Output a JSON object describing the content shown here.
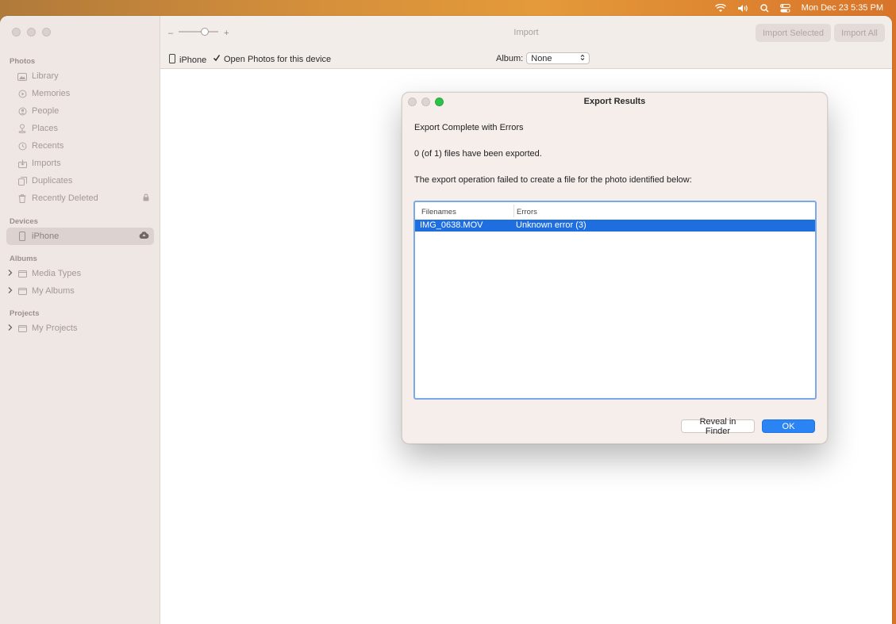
{
  "menubar": {
    "datetime": "Mon Dec 23  5:35 PM"
  },
  "toolbar": {
    "zoom_minus": "–",
    "zoom_plus": "+",
    "title": "Import",
    "import_selected": "Import Selected",
    "import_all": "Import All"
  },
  "subbar": {
    "device": "iPhone",
    "open_photos_label": "Open Photos for this device",
    "album_label": "Album:",
    "album_value": "None"
  },
  "sidebar": {
    "photos_section": "Photos",
    "photos_items": [
      "Library",
      "Memories",
      "People",
      "Places",
      "Recents",
      "Imports",
      "Duplicates",
      "Recently Deleted"
    ],
    "devices_section": "Devices",
    "device_item": "iPhone",
    "albums_section": "Albums",
    "albums_items": [
      "Media Types",
      "My Albums"
    ],
    "projects_section": "Projects",
    "projects_items": [
      "My Projects"
    ]
  },
  "dialog": {
    "title": "Export Results",
    "heading": "Export Complete with Errors",
    "summary": "0 (of 1) files have been exported.",
    "explanation": "The export operation failed to create a file for the photo identified below:",
    "columns": [
      "Filenames",
      "Errors"
    ],
    "rows": [
      {
        "filename": "IMG_0638.MOV",
        "error": "Unknown error (3)"
      }
    ],
    "reveal_button": "Reveal in Finder",
    "ok_button": "OK"
  },
  "colors": {
    "accent": "#2a84f3",
    "selection": "#1e6ee0",
    "traffic_green": "#2fc04a"
  }
}
